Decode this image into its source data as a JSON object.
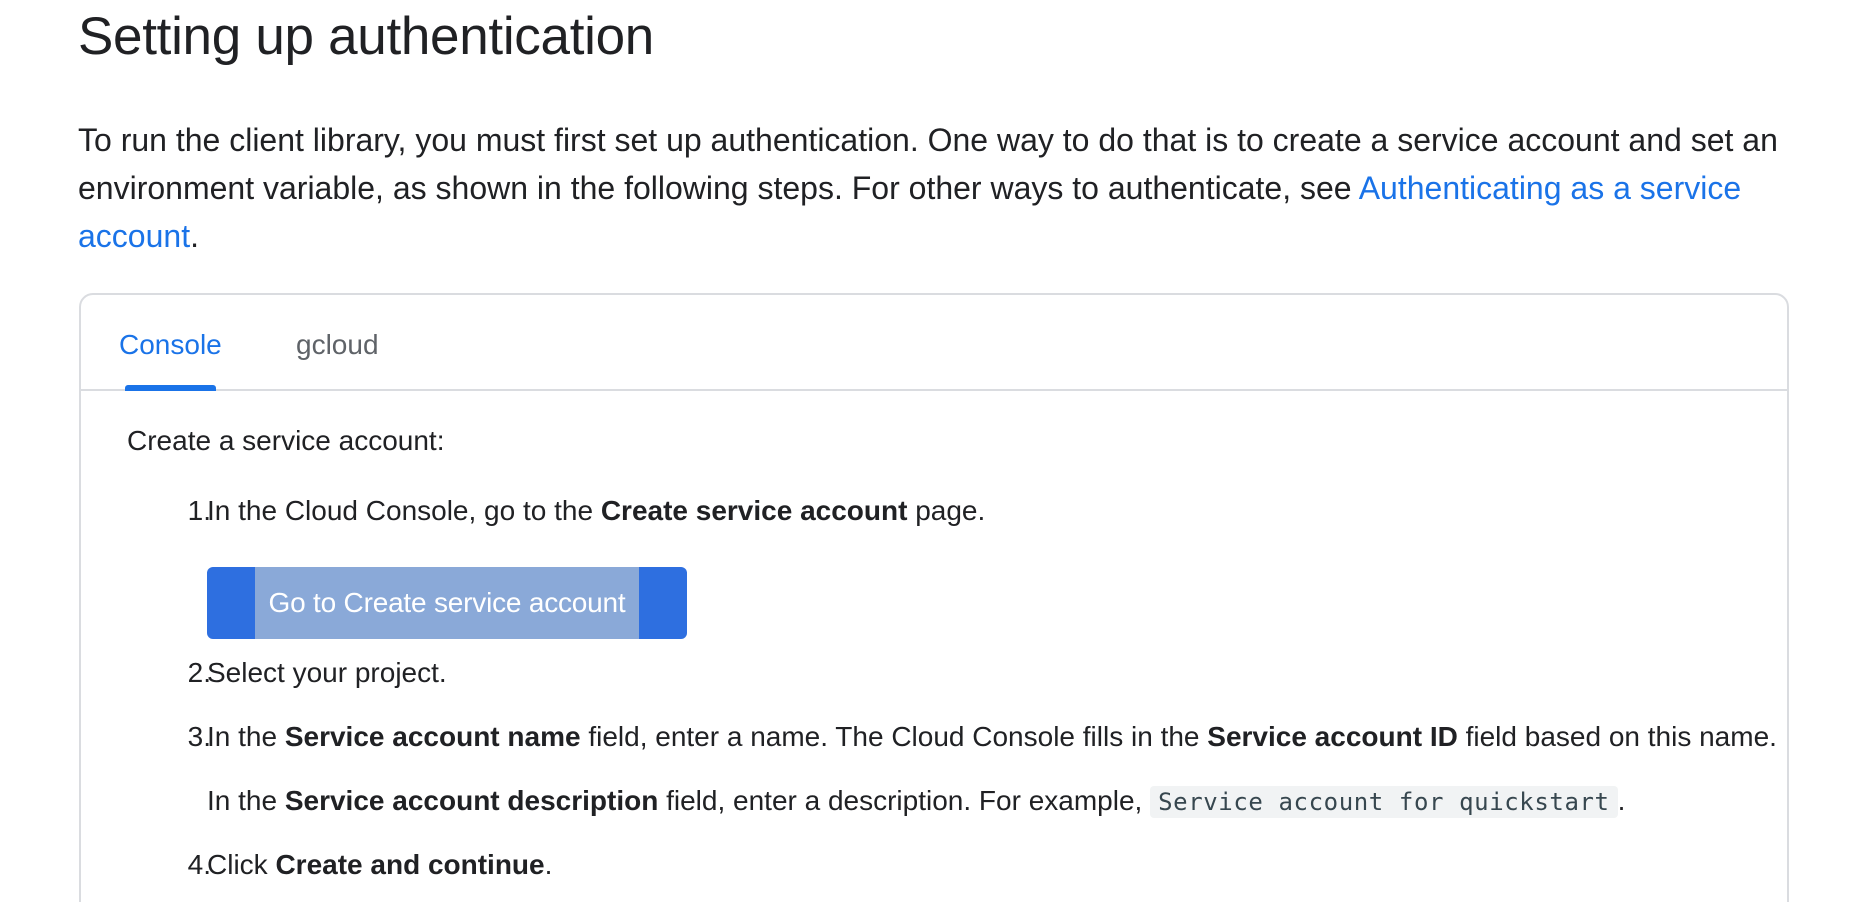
{
  "page": {
    "title": "Setting up authentication",
    "intro_text": "To run the client library, you must first set up authentication. One way to do that is to create a service account and set an environment variable, as shown in the following steps. For other ways to authenticate, see ",
    "intro_link": "Authenticating as a service account",
    "intro_end": "."
  },
  "tabs": [
    {
      "label": "Console",
      "selected": true
    },
    {
      "label": "gcloud",
      "selected": false
    }
  ],
  "console_panel": {
    "intro": "Create a service account:",
    "steps": [
      {
        "number": "1.",
        "text_before": "In the Cloud Console, go to the ",
        "bold": "Create service account",
        "text_after": " page.",
        "button_label": "Go to Create service account"
      },
      {
        "number": "2.",
        "text": "Select your project."
      },
      {
        "number": "3.",
        "text_a": "In the ",
        "bold_a": "Service account name",
        "text_b": " field, enter a name. The Cloud Console fills in the ",
        "bold_b": "Service account ID",
        "text_c": " field based on this name.",
        "sub_text_a": "In the ",
        "sub_bold": "Service account description",
        "sub_text_b": " field, enter a description. For example, ",
        "sub_code": "Service account for quickstart",
        "sub_text_c": "."
      },
      {
        "number": "4.",
        "text_before": "Click ",
        "bold": "Create and continue",
        "text_after": "."
      }
    ]
  },
  "colors": {
    "link": "#1a73e8",
    "button": "#2e6fe0",
    "button_label_highlight": "#8aa9d8",
    "text": "#202124"
  }
}
